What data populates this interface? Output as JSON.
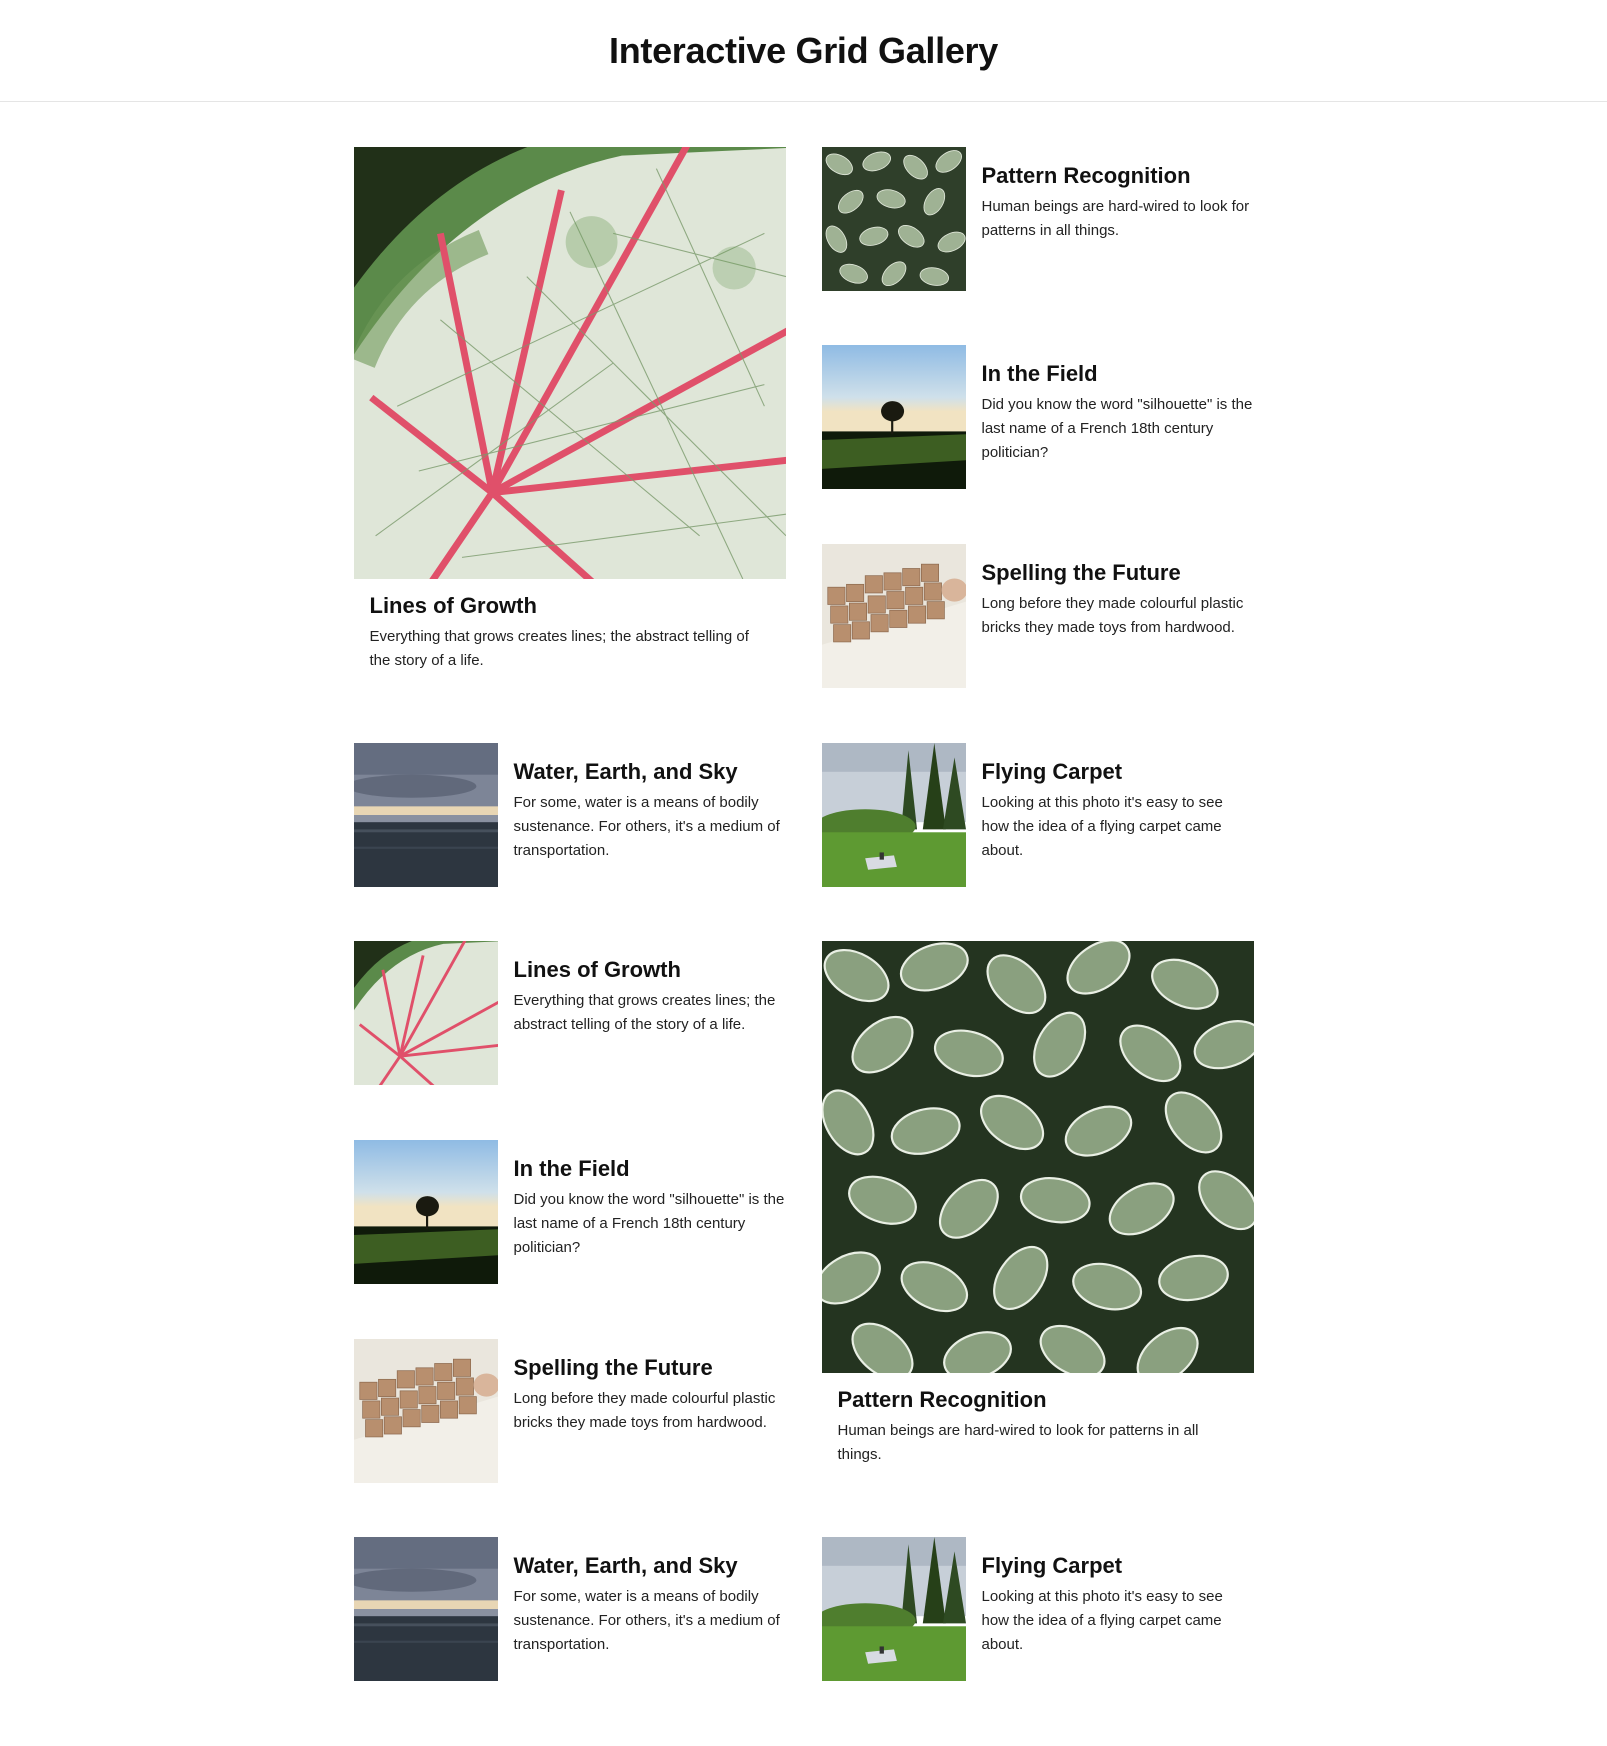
{
  "header": {
    "title": "Interactive Grid Gallery"
  },
  "cards": {
    "leaf_big": {
      "title": "Lines of Growth",
      "desc": "Everything that grows creates lines; the abstract telling of the story of a life."
    },
    "pattern_1": {
      "title": "Pattern Recognition",
      "desc": "Human beings are hard-wired to look for patterns in all things."
    },
    "field_1": {
      "title": "In the Field",
      "desc": "Did you know the word \"silhouette\" is the last name of a French 18th century politician?"
    },
    "spelling_1": {
      "title": "Spelling the Future",
      "desc": "Long before they made colourful plastic bricks they made toys from hardwood."
    },
    "water_1": {
      "title": "Water, Earth, and Sky",
      "desc": "For some, water is a means of bodily sustenance. For others, it's a medium of transportation."
    },
    "carpet_1": {
      "title": "Flying Carpet",
      "desc": "Looking at this photo it's easy to see how the idea of a flying carpet came about."
    },
    "leaf_small": {
      "title": "Lines of Growth",
      "desc": "Everything that grows creates lines; the abstract telling of the story of a life."
    },
    "pattern_big": {
      "title": "Pattern Recognition",
      "desc": "Human beings are hard-wired to look for patterns in all things."
    },
    "field_2": {
      "title": "In the Field",
      "desc": "Did you know the word \"silhouette\" is the last name of a French 18th century politician?"
    },
    "spelling_2": {
      "title": "Spelling the Future",
      "desc": "Long before they made colourful plastic bricks they made toys from hardwood."
    },
    "water_2": {
      "title": "Water, Earth, and Sky",
      "desc": "For some, water is a means of bodily sustenance. For others, it's a medium of transportation."
    },
    "carpet_2": {
      "title": "Flying Carpet",
      "desc": "Looking at this photo it's easy to see how the idea of a flying carpet came about."
    }
  },
  "colors": {
    "leaf_white": "#e6ebe0",
    "leaf_pink": "#e0506a",
    "leaf_green": "#4a7a3c",
    "grass": "#4d8a2a",
    "sky_blue": "#9cc4e4",
    "water_dark": "#2d3640",
    "wood": "#b88f6e"
  }
}
